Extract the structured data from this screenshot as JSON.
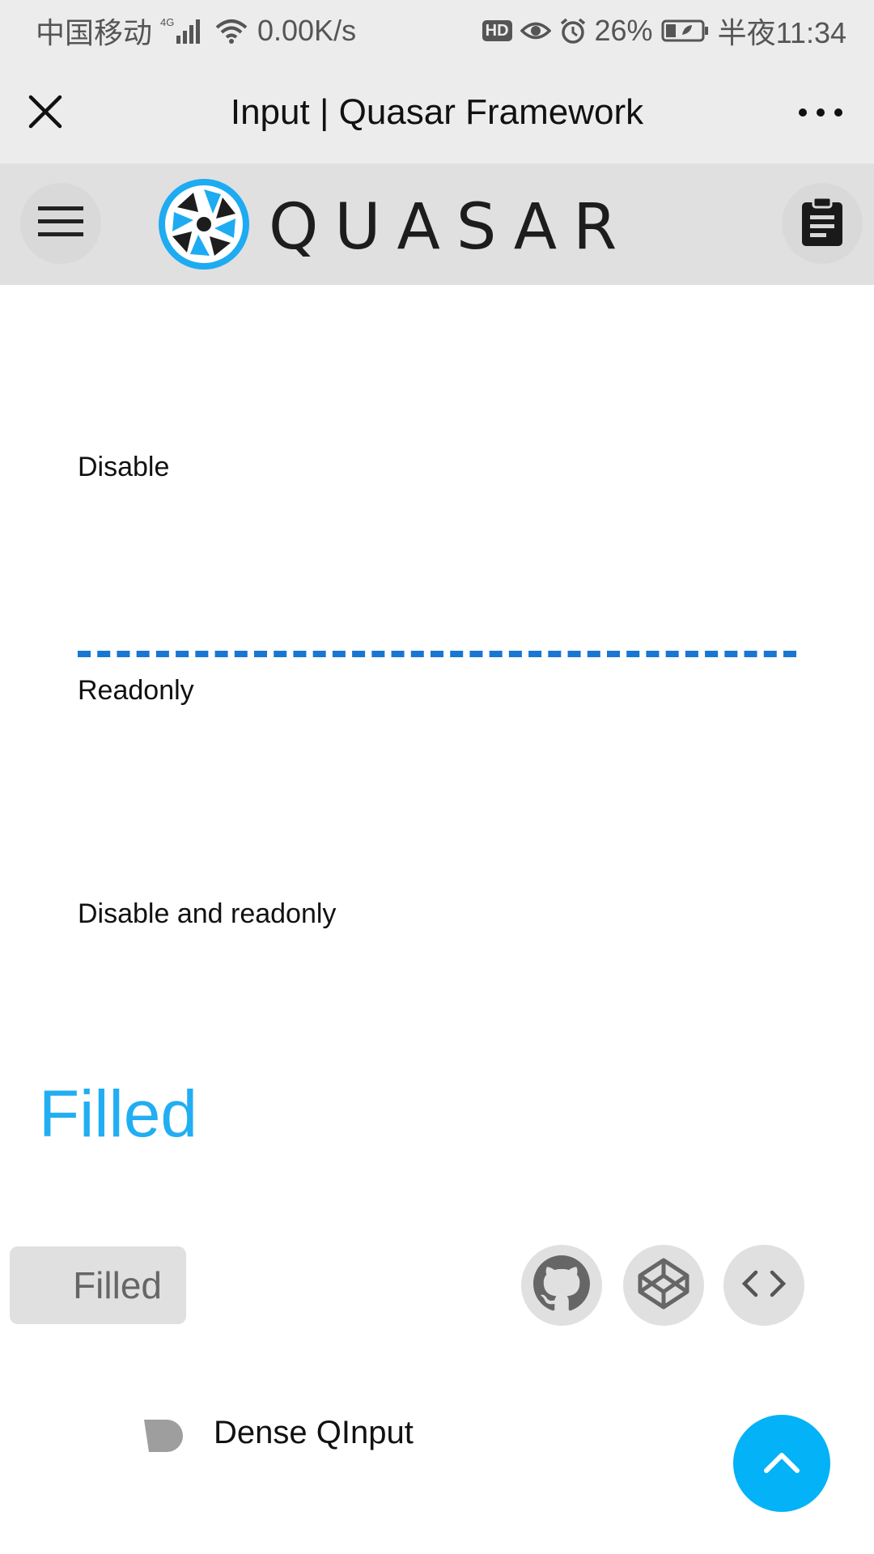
{
  "status_bar": {
    "carrier": "中国移动",
    "network": "4G",
    "speed": "0.00K/s",
    "hd": "HD",
    "battery": "26%",
    "time": "半夜11:34"
  },
  "title_bar": {
    "title": "Input | Quasar Framework"
  },
  "header": {
    "brand": "QUASAR"
  },
  "content": {
    "labels": [
      "Disable",
      "Readonly",
      "Disable and readonly"
    ],
    "section_title": "Filled",
    "example_tab": "Filled",
    "dense_label": "Dense QInput"
  },
  "colors": {
    "accent": "#21aef3",
    "dashed_line": "#1976d2",
    "fab": "#03b2f7"
  },
  "icons": {
    "close": "close-icon",
    "more": "more-dots-icon",
    "menu": "hamburger-menu-icon",
    "clipboard": "clipboard-icon",
    "github": "github-icon",
    "codepen": "codepen-icon",
    "code": "code-icon",
    "scroll_top": "chevron-up-icon"
  }
}
